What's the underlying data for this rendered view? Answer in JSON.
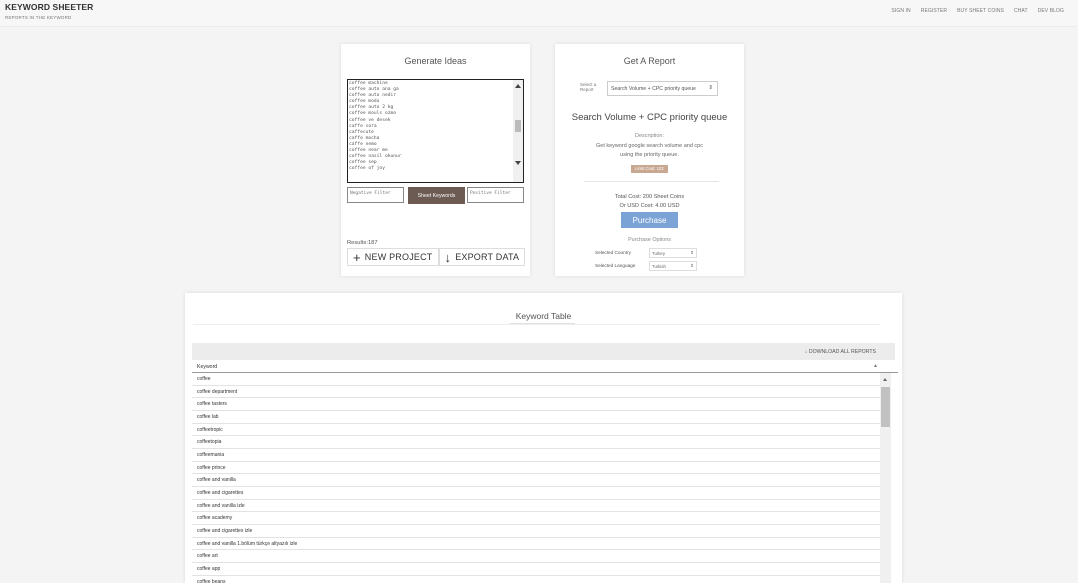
{
  "brand": {
    "title": "KEYWORD SHEETER",
    "subtitle": "REPORTS IN THE KEYWORD"
  },
  "nav": [
    "SIGN IN",
    "REGISTER",
    "BUY SHEET COINS",
    "CHAT",
    "DEV BLOG"
  ],
  "generate": {
    "title": "Generate Ideas",
    "seed_lines": [
      "coffee machine",
      "coffee auto ana ga",
      "coffee auto nedir",
      "coffee modu",
      "coffee auto 2 kg",
      "coffee mouls ozmo",
      "coffee ve desek",
      "caffe sora",
      "caffecute",
      "caffe mocha",
      "caffe nemo",
      "coffee near me",
      "coffee nasil okunur",
      "coffee sep",
      "coffee of joy"
    ],
    "negative_placeholder": "Negative Filter",
    "positive_placeholder": "Positive Filter",
    "sheet_button": "Sheet Keywords",
    "results": "Results:187",
    "new_project": "NEW PROJECT",
    "export_data": "EXPORT DATA"
  },
  "report": {
    "title": "Get A Report",
    "select_label": "Select a Report",
    "select_value": "Search Volume + CPC priority queue",
    "heading": "Search Volume + CPC priority queue",
    "description_title": "Description:",
    "description": "Get keyword google search volume and cpc using the priority queue.",
    "limit_badge": "Limit Cost: 122",
    "total_cost": "Total Cost: 200 Sheet Coins",
    "usd_cost": "Or USD Cost: 4.00 USD",
    "purchase": "Purchase",
    "options_title": "Purchase Options",
    "country_label": "Selected Country",
    "country_value": "Turkey",
    "language_label": "Selected Language",
    "language_value": "Turkish"
  },
  "table": {
    "title": "Keyword Table",
    "download_all": "DOWNLOAD ALL REPORTS",
    "column": "Keyword",
    "rows": [
      "coffee",
      "coffee department",
      "coffee tasters",
      "coffee lab",
      "coffeetropic",
      "coffeetopia",
      "coffeemania",
      "coffee prince",
      "coffee and vanilla",
      "coffee and cigarettes",
      "coffee and vanilla izle",
      "coffee academy",
      "coffee and cigarettes izle",
      "coffee and vanilla 1.bölüm türkçe altyazılı izle",
      "coffee art",
      "coffee app",
      "coffee beans"
    ]
  },
  "icons": {
    "new_project": "plus-icon",
    "export_data": "download-icon",
    "download_all": "download-icon",
    "sort": "sort-caret-icon"
  }
}
